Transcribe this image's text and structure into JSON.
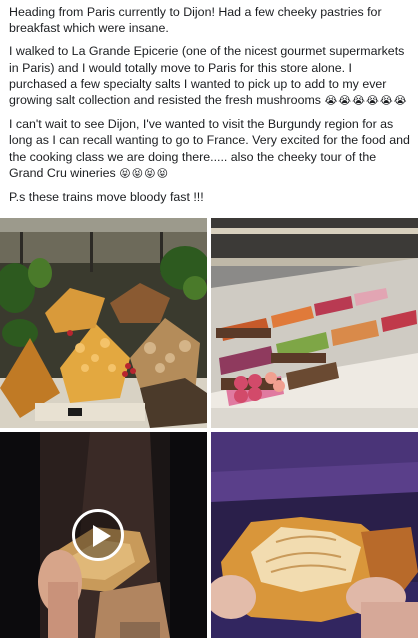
{
  "post": {
    "paragraphs": [
      "Heading from Paris currently to Dijon! Had a few cheeky pastries for breakfast which were insane.",
      "I walked to La Grande Epicerie (one of the nicest gourmet supermarkets in Paris) and I would totally move to Paris for this store alone. I purchased a few specialty salts I wanted to pick up to add to my ever growing salt collection and resisted the fresh mushrooms",
      "I can't wait to see Dijon, I've wanted to visit the Burgundy region for as long as I can recall wanting to go to France. Very excited for the food and the cooking class we are doing there..... also the cheeky tour of the Grand Cru wineries",
      "P.s these trains move bloody fast !!!"
    ],
    "emoji_p2": "😭😭😭😭😭😭",
    "emoji_p3": "😝😝😝😝"
  },
  "photos": [
    {
      "icon": "mushroom-market-photo"
    },
    {
      "icon": "macaron-display-photo"
    },
    {
      "icon": "video-pastry-photo"
    },
    {
      "icon": "croissant-photo"
    }
  ],
  "video": {
    "icon": "play-icon"
  }
}
